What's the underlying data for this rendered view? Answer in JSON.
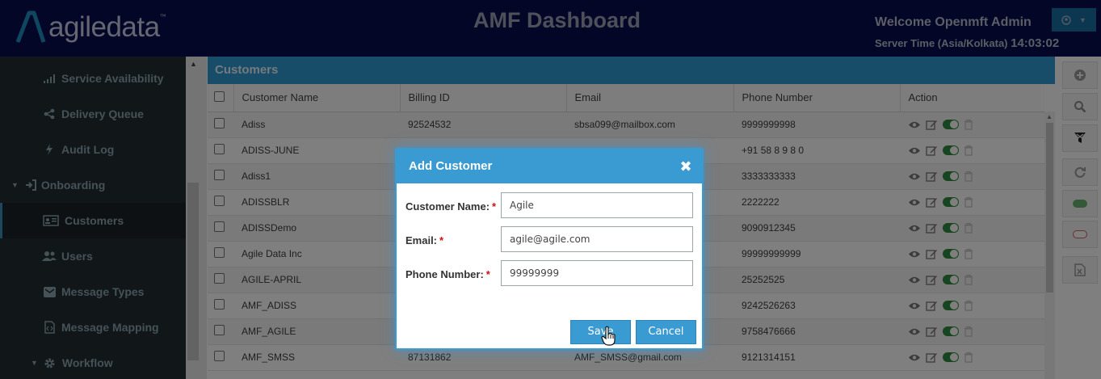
{
  "header": {
    "logo_text": "agiledata",
    "logo_tm": "™",
    "app_title": "AMF Dashboard",
    "welcome": "Welcome Openmft Admin",
    "server_time_label": "Server Time (Asia/Kolkata)",
    "server_time": "14:03:02",
    "user_menu_icon": "user-circle-icon",
    "user_menu_caret": "▼"
  },
  "sidebar": {
    "items": [
      {
        "label": "Service Availability",
        "icon": "signal-icon"
      },
      {
        "label": "Delivery Queue",
        "icon": "share-icon"
      },
      {
        "label": "Audit Log",
        "icon": "bolt-icon"
      },
      {
        "label": "Onboarding",
        "icon": "sign-in-icon"
      },
      {
        "label": "Customers",
        "icon": "id-card-icon"
      },
      {
        "label": "Users",
        "icon": "users-icon"
      },
      {
        "label": "Message Types",
        "icon": "envelope-icon"
      },
      {
        "label": "Message Mapping",
        "icon": "file-code-icon"
      },
      {
        "label": "Workflow",
        "icon": "gear-icon"
      }
    ]
  },
  "panel": {
    "title": "Customers"
  },
  "table": {
    "columns": [
      "Customer Name",
      "Billing ID",
      "Email",
      "Phone Number",
      "Action"
    ],
    "rows": [
      {
        "name": "Adiss",
        "billing": "92524532",
        "email": "sbsa099@mailbox.com",
        "phone": "9999999998"
      },
      {
        "name": "ADISS-JUNE",
        "billing": "",
        "email": "",
        "phone": "+91 58 8 9 8 0"
      },
      {
        "name": "Adiss1",
        "billing": "",
        "email": "",
        "phone": "3333333333"
      },
      {
        "name": "ADISSBLR",
        "billing": "",
        "email": "",
        "phone": "2222222"
      },
      {
        "name": "ADISSDemo",
        "billing": "",
        "email": "",
        "phone": "9090912345"
      },
      {
        "name": "Agile Data Inc",
        "billing": "",
        "email": "",
        "phone": "99999999999"
      },
      {
        "name": "AGILE-APRIL",
        "billing": "",
        "email": "",
        "phone": "25252525"
      },
      {
        "name": "AMF_ADISS",
        "billing": "",
        "email": "",
        "phone": "9242526263"
      },
      {
        "name": "AMF_AGILE",
        "billing": "",
        "email": "",
        "phone": "9758476666"
      },
      {
        "name": "AMF_SMSS",
        "billing": "87131862",
        "email": "AMF_SMSS@gmail.com",
        "phone": "9121314151"
      }
    ]
  },
  "toolbar": {
    "icons": [
      "plus-circle-icon",
      "search-icon",
      "filter-icon",
      "refresh-icon",
      "toggle-on-icon",
      "toggle-off-icon",
      "excel-export-icon"
    ]
  },
  "modal": {
    "title": "Add Customer",
    "close_glyph": "✖",
    "fields": [
      {
        "label": "Customer Name:",
        "required": "*",
        "value": "Agile"
      },
      {
        "label": "Email:",
        "required": "*",
        "value": "agile@agile.com"
      },
      {
        "label": "Phone Number:",
        "required": "*",
        "value": "99999999"
      }
    ],
    "save_label": "Save",
    "cancel_label": "Cancel"
  },
  "colors": {
    "header_bg": "#070c4f",
    "sidebar_bg": "#222d32",
    "accent": "#3a9ad2",
    "panel_head": "#2f9bd1",
    "toggle_on": "#2e8a3e",
    "required": "#cc1111"
  }
}
